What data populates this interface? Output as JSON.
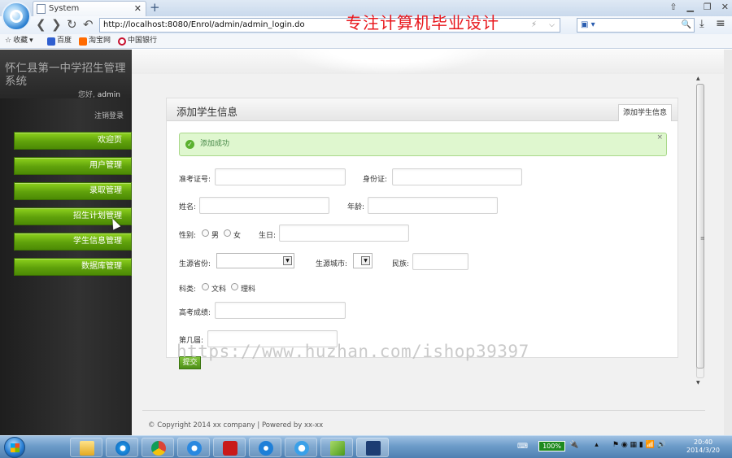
{
  "browser": {
    "tab_title": "System",
    "tab_close": "✕",
    "new_tab": "+",
    "address": "http://localhost:8080/Enrol/admin/admin_login.do",
    "address_flash": "⚡",
    "address_drop": "⌵",
    "engine_search": "🔍",
    "nav_back": "❮",
    "nav_forward": "❯",
    "nav_refresh": "↻",
    "nav_undo": "↶",
    "win_controls": [
      "⇧",
      "▁",
      "❐",
      "✕"
    ]
  },
  "watermark_top": "专注计算机毕业设计",
  "bookmarks": [
    "收藏",
    "百度",
    "淘宝网",
    "中国银行"
  ],
  "sidebar": {
    "title": "怀仁县第一中学招生管理系统",
    "greeting_prefix": "您好,",
    "username": "admin",
    "logout": "注销登录",
    "menu": [
      "欢迎页",
      "用户管理",
      "录取管理",
      "招生计划管理",
      "学生信息管理",
      "数据库管理"
    ]
  },
  "panel": {
    "title": "添加学生信息",
    "tab": "添加学生信息",
    "alert": "添加成功",
    "alert_close": "×",
    "fields": {
      "exam_no": "准考证号:",
      "id_card": "身份证:",
      "name": "姓名:",
      "age": "年龄:",
      "gender": "性别:",
      "male": "男",
      "female": "女",
      "birthday": "生日:",
      "province": "生源省份:",
      "city": "生源城市:",
      "ethnicity": "民族:",
      "subject": "科类:",
      "arts": "文科",
      "science": "理科",
      "score": "高考成绩:",
      "session": "第几届:"
    },
    "submit": "提交"
  },
  "footer": "© Copyright 2014 xx company | Powered by xx-xx",
  "watermark_mid": "https://www.huzhan.com/ishop39397",
  "taskbar": {
    "battery": "100%",
    "time": "20:40",
    "date": "2014/3/20"
  },
  "colors": {
    "menu_green": "#6cb514",
    "alert_bg": "#dff7cf",
    "watermark_red": "#e8161c"
  }
}
